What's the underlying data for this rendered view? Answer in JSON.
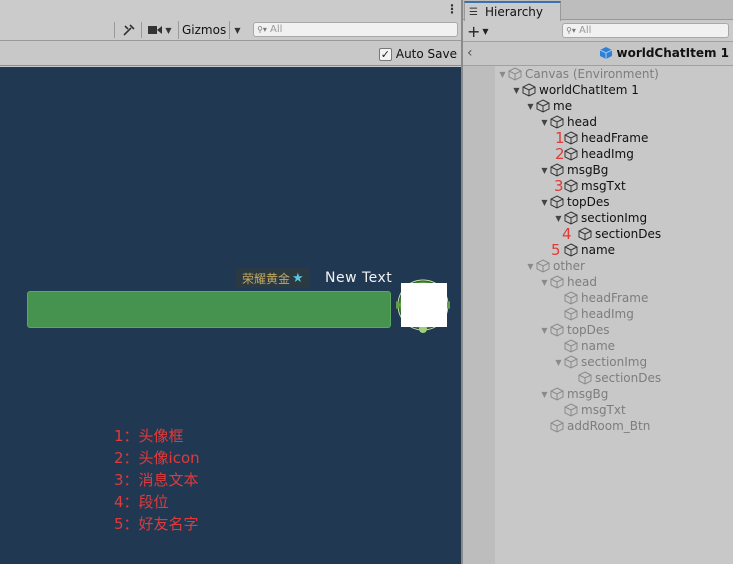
{
  "scene": {
    "toolbar": {
      "gizmos_label": "Gizmos",
      "search_placeholder": "All"
    },
    "autosave_label": "Auto Save",
    "preview": {
      "section_des": "荣耀黄金",
      "name": "New  Text"
    },
    "legend": [
      "1：头像框",
      "2：头像icon",
      "3：消息文本",
      "4：段位",
      "5：好友名字"
    ]
  },
  "hierarchy": {
    "tab_label": "Hierarchy",
    "search_placeholder": "All",
    "breadcrumb_label": "worldChatItem 1",
    "tree": [
      {
        "label": "Canvas (Environment)"
      },
      {
        "label": "worldChatItem 1"
      },
      {
        "label": "me"
      },
      {
        "label": "head"
      },
      {
        "label": "headFrame",
        "marker": "1"
      },
      {
        "label": "headImg",
        "marker": "2"
      },
      {
        "label": "msgBg"
      },
      {
        "label": "msgTxt",
        "marker": "3"
      },
      {
        "label": "topDes"
      },
      {
        "label": "sectionImg"
      },
      {
        "label": "sectionDes",
        "marker": "4"
      },
      {
        "label": "name",
        "marker": "5"
      },
      {
        "label": "other"
      },
      {
        "label": "head"
      },
      {
        "label": "headFrame"
      },
      {
        "label": "headImg"
      },
      {
        "label": "topDes"
      },
      {
        "label": "name"
      },
      {
        "label": "sectionImg"
      },
      {
        "label": "sectionDes"
      },
      {
        "label": "msgBg"
      },
      {
        "label": "msgTxt"
      },
      {
        "label": "addRoom_Btn"
      }
    ]
  },
  "colors": {
    "viewport_bg": "#213853",
    "message_bubble": "#45934e",
    "annotation_red": "#e03a3a",
    "section_gold": "#c2a864"
  }
}
